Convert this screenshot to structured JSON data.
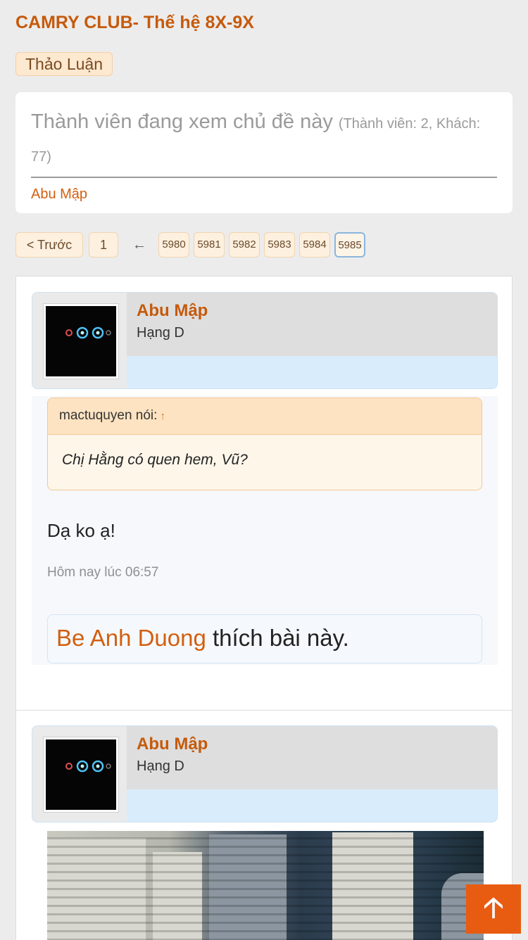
{
  "thread": {
    "title": "CAMRY CLUB- Thế hệ 8X-9X"
  },
  "breadcrumb": {
    "label": "Thảo Luận"
  },
  "viewers": {
    "heading": "Thành viên đang xem chủ đề này",
    "count": "(Thành viên: 2, Khách: 77)",
    "names": [
      "Abu Mập"
    ]
  },
  "pagination": {
    "prev": "< Trước",
    "first": "1",
    "ellipsis": "←",
    "pages": [
      "5980",
      "5981",
      "5982",
      "5983",
      "5984",
      "5985"
    ],
    "current": "5985"
  },
  "posts": [
    {
      "author": "Abu Mập",
      "rank": "Hạng D",
      "quote": {
        "author_line": "mactuquyen nói:",
        "arrow": "↑",
        "text": "Chị Hằng có quen hem, Vũ?"
      },
      "message": "Dạ ko ạ!",
      "date": "Hôm nay lúc 06:57",
      "likes": {
        "who": "Be Anh Duong",
        "suffix": " thích bài này."
      }
    },
    {
      "author": "Abu Mập",
      "rank": "Hạng D"
    }
  ],
  "scroll_top": {
    "icon": "arrow-up-icon",
    "glyph": "🡡"
  },
  "colors": {
    "accent": "#c65a0c",
    "link": "#d25f10",
    "scroll_button": "#e85c12"
  }
}
